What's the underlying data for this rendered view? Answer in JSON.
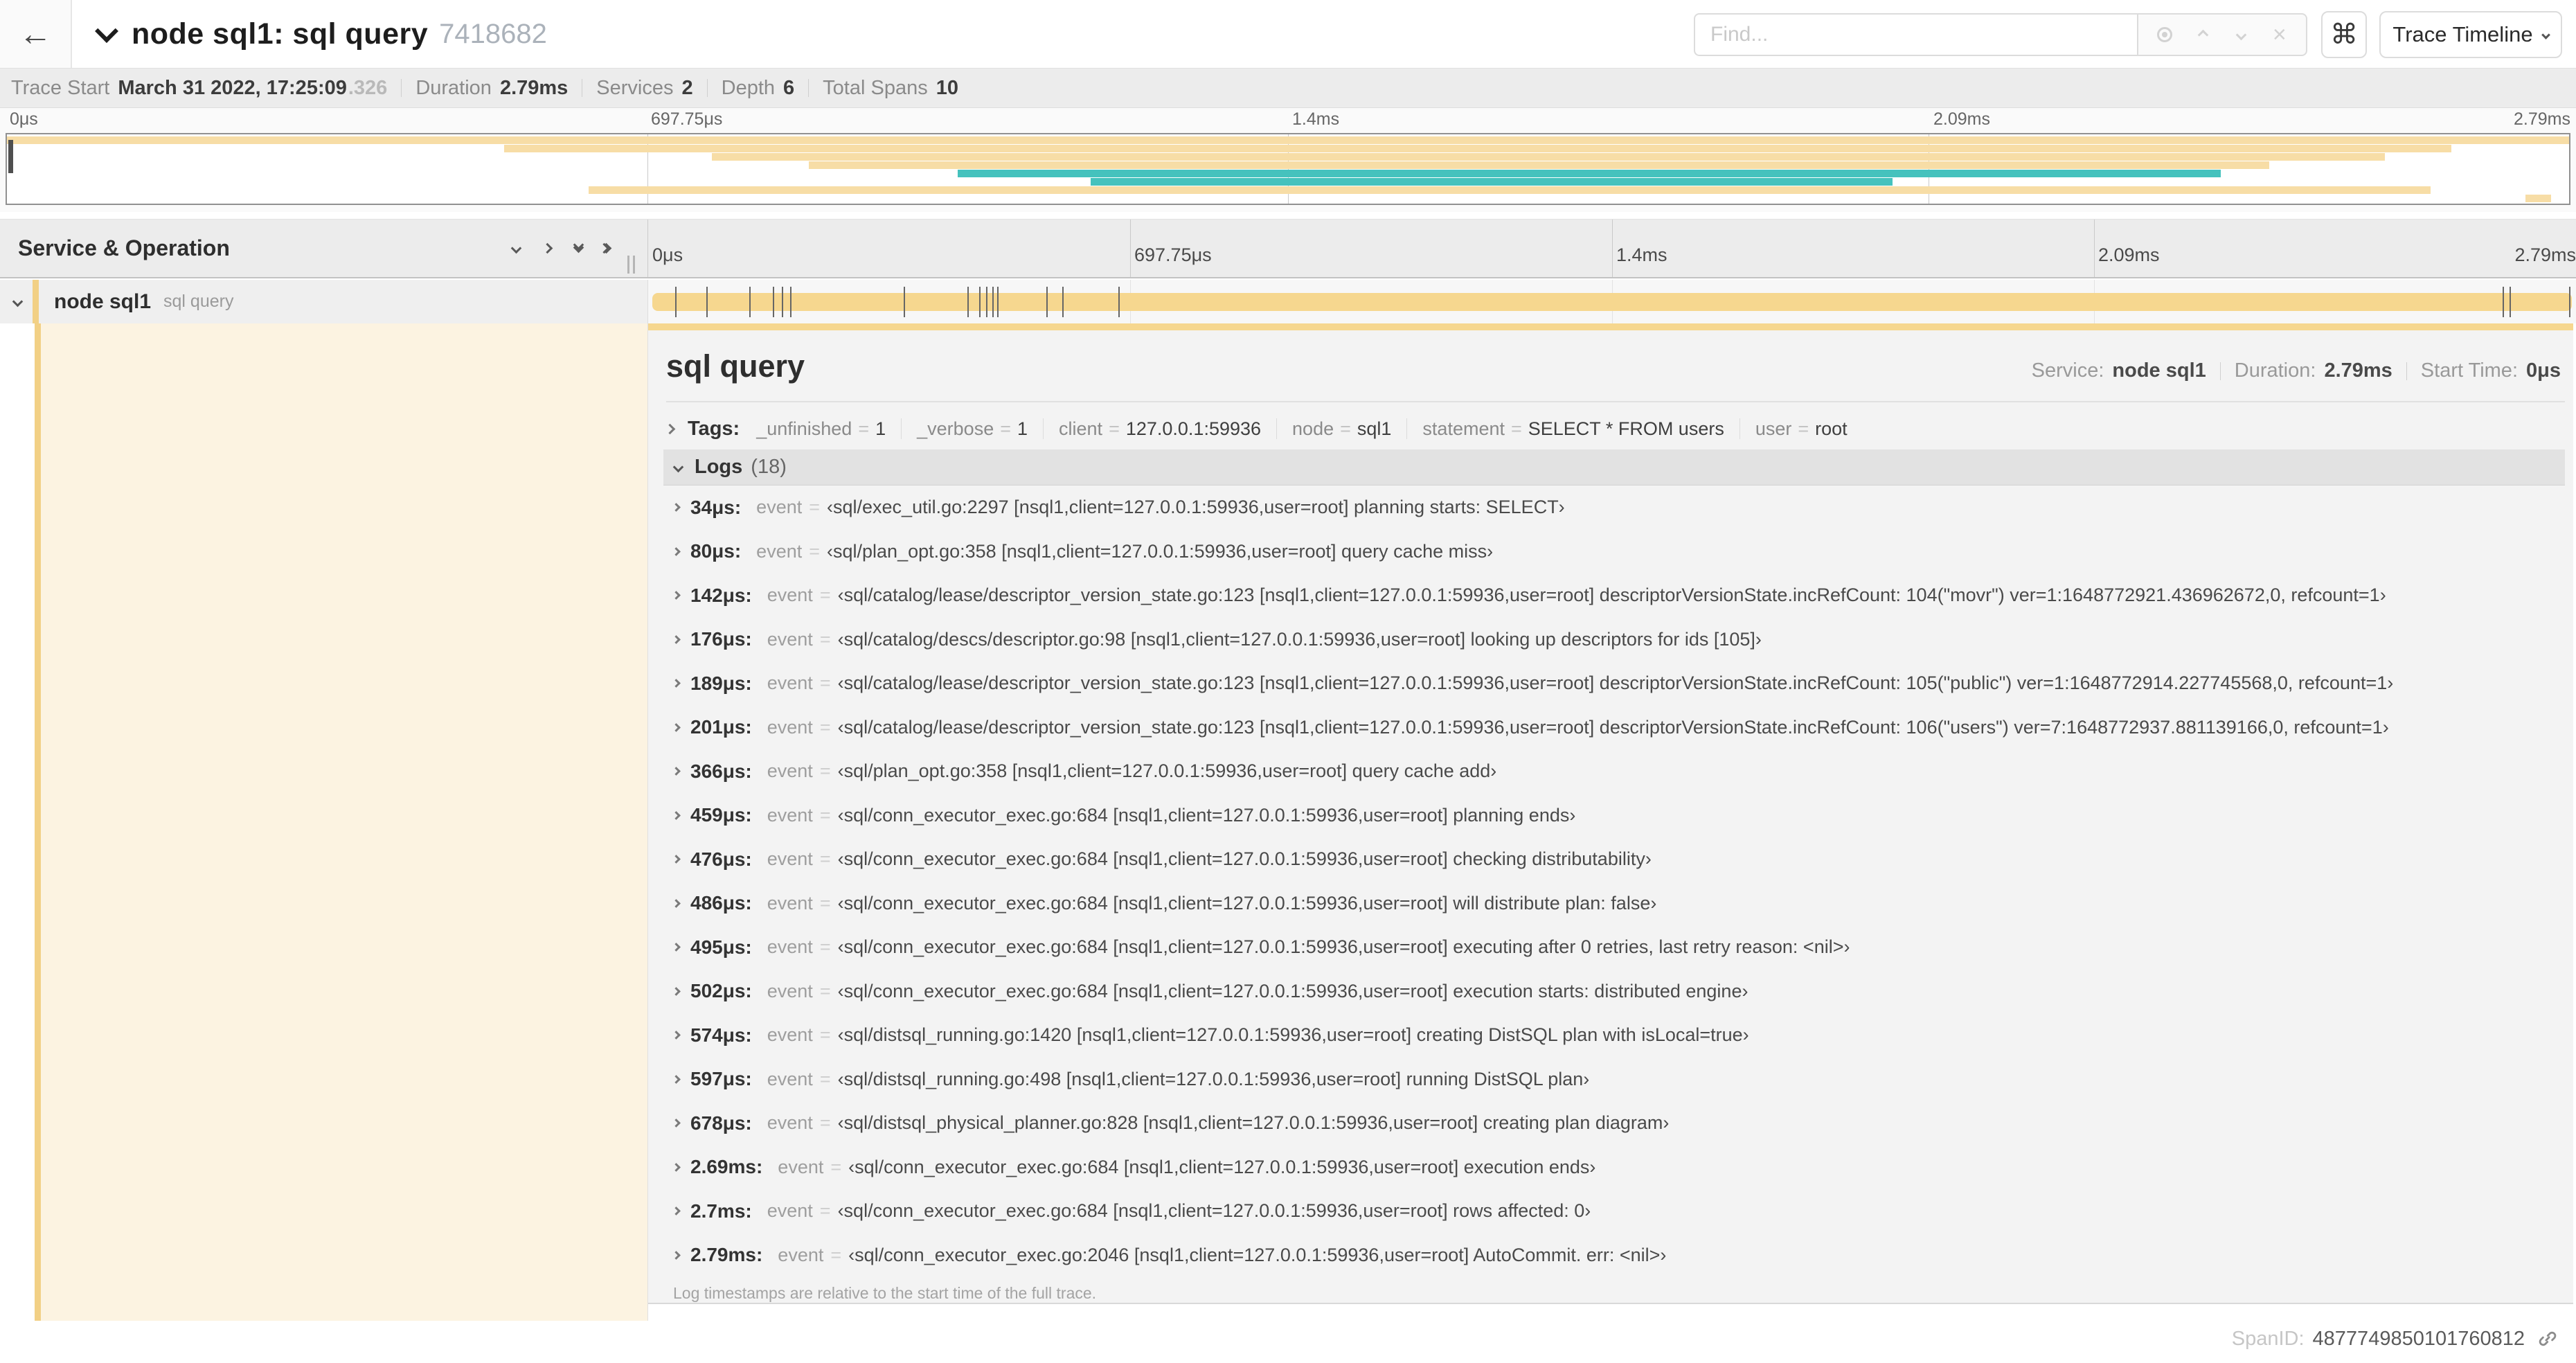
{
  "header": {
    "back_icon": "←",
    "title": "node sql1: sql query",
    "trace_id": "7418682",
    "find_placeholder": "Find...",
    "shortcut_icon": "⌘",
    "clear_icon": "×",
    "view_selector_label": "Trace Timeline"
  },
  "summary": {
    "items": [
      {
        "label": "Trace Start",
        "value": "March 31 2022, 17:25:09",
        "suffix": ".326"
      },
      {
        "label": "Duration",
        "value": "2.79ms"
      },
      {
        "label": "Services",
        "value": "2"
      },
      {
        "label": "Depth",
        "value": "6"
      },
      {
        "label": "Total Spans",
        "value": "10"
      }
    ]
  },
  "minimap": {
    "ticks": [
      "0μs",
      "697.75μs",
      "1.4ms",
      "2.09ms",
      "2.79ms"
    ],
    "spans": [
      {
        "start": 0,
        "end": 100,
        "color": "#f7dda6"
      },
      {
        "start": 19.4,
        "end": 95.4,
        "color": "#f7dda6"
      },
      {
        "start": 27.5,
        "end": 92.8,
        "color": "#f7dda6"
      },
      {
        "start": 31.3,
        "end": 88.3,
        "color": "#f7dda6"
      },
      {
        "start": 37.1,
        "end": 86.4,
        "color": "#45c2bd"
      },
      {
        "start": 42.3,
        "end": 73.6,
        "color": "#45c2bd"
      },
      {
        "start": 22.7,
        "end": 94.6,
        "color": "#f7dda6"
      },
      {
        "start": 98.3,
        "end": 99.3,
        "color": "#f7dda6"
      }
    ]
  },
  "timeline": {
    "left_header": "Service & Operation",
    "ticks": [
      "0μs",
      "697.75μs",
      "1.4ms",
      "2.09ms",
      "2.79ms"
    ],
    "total_us": 2790,
    "span": {
      "service": "node sql1",
      "operation": "sql query"
    }
  },
  "detail": {
    "title": "sql query",
    "meta": [
      {
        "label": "Service:",
        "value": "node sql1"
      },
      {
        "label": "Duration:",
        "value": "2.79ms"
      },
      {
        "label": "Start Time:",
        "value": "0μs"
      }
    ],
    "tags_label": "Tags:",
    "tags": [
      {
        "key": "_unfinished",
        "value": "1"
      },
      {
        "key": "_verbose",
        "value": "1"
      },
      {
        "key": "client",
        "value": "127.0.0.1:59936"
      },
      {
        "key": "node",
        "value": "sql1"
      },
      {
        "key": "statement",
        "value": "SELECT * FROM users"
      },
      {
        "key": "user",
        "value": "root"
      }
    ],
    "logs_label": "Logs",
    "logs_count_display": "(18)",
    "logs": [
      {
        "time": "34μs:",
        "t_us": 34,
        "key": "event",
        "value": "‹sql/exec_util.go:2297 [nsql1,client=127.0.0.1:59936,user=root] planning starts: SELECT›"
      },
      {
        "time": "80μs:",
        "t_us": 80,
        "key": "event",
        "value": "‹sql/plan_opt.go:358 [nsql1,client=127.0.0.1:59936,user=root] query cache miss›"
      },
      {
        "time": "142μs:",
        "t_us": 142,
        "key": "event",
        "value": "‹sql/catalog/lease/descriptor_version_state.go:123 [nsql1,client=127.0.0.1:59936,user=root] descriptorVersionState.incRefCount: 104(\"movr\") ver=1:1648772921.436962672,0, refcount=1›"
      },
      {
        "time": "176μs:",
        "t_us": 176,
        "key": "event",
        "value": "‹sql/catalog/descs/descriptor.go:98 [nsql1,client=127.0.0.1:59936,user=root] looking up descriptors for ids [105]›"
      },
      {
        "time": "189μs:",
        "t_us": 189,
        "key": "event",
        "value": "‹sql/catalog/lease/descriptor_version_state.go:123 [nsql1,client=127.0.0.1:59936,user=root] descriptorVersionState.incRefCount: 105(\"public\") ver=1:1648772914.227745568,0, refcount=1›"
      },
      {
        "time": "201μs:",
        "t_us": 201,
        "key": "event",
        "value": "‹sql/catalog/lease/descriptor_version_state.go:123 [nsql1,client=127.0.0.1:59936,user=root] descriptorVersionState.incRefCount: 106(\"users\") ver=7:1648772937.881139166,0, refcount=1›"
      },
      {
        "time": "366μs:",
        "t_us": 366,
        "key": "event",
        "value": "‹sql/plan_opt.go:358 [nsql1,client=127.0.0.1:59936,user=root] query cache add›"
      },
      {
        "time": "459μs:",
        "t_us": 459,
        "key": "event",
        "value": "‹sql/conn_executor_exec.go:684 [nsql1,client=127.0.0.1:59936,user=root] planning ends›"
      },
      {
        "time": "476μs:",
        "t_us": 476,
        "key": "event",
        "value": "‹sql/conn_executor_exec.go:684 [nsql1,client=127.0.0.1:59936,user=root] checking distributability›"
      },
      {
        "time": "486μs:",
        "t_us": 486,
        "key": "event",
        "value": "‹sql/conn_executor_exec.go:684 [nsql1,client=127.0.0.1:59936,user=root] will distribute plan: false›"
      },
      {
        "time": "495μs:",
        "t_us": 495,
        "key": "event",
        "value": "‹sql/conn_executor_exec.go:684 [nsql1,client=127.0.0.1:59936,user=root] executing after 0 retries, last retry reason: <nil>›"
      },
      {
        "time": "502μs:",
        "t_us": 502,
        "key": "event",
        "value": "‹sql/conn_executor_exec.go:684 [nsql1,client=127.0.0.1:59936,user=root] execution starts: distributed engine›"
      },
      {
        "time": "574μs:",
        "t_us": 574,
        "key": "event",
        "value": "‹sql/distsql_running.go:1420 [nsql1,client=127.0.0.1:59936,user=root] creating DistSQL plan with isLocal=true›"
      },
      {
        "time": "597μs:",
        "t_us": 597,
        "key": "event",
        "value": "‹sql/distsql_running.go:498 [nsql1,client=127.0.0.1:59936,user=root] running DistSQL plan›"
      },
      {
        "time": "678μs:",
        "t_us": 678,
        "key": "event",
        "value": "‹sql/distsql_physical_planner.go:828 [nsql1,client=127.0.0.1:59936,user=root] creating plan diagram›"
      },
      {
        "time": "2.69ms:",
        "t_us": 2690,
        "key": "event",
        "value": "‹sql/conn_executor_exec.go:684 [nsql1,client=127.0.0.1:59936,user=root] execution ends›"
      },
      {
        "time": "2.7ms:",
        "t_us": 2700,
        "key": "event",
        "value": "‹sql/conn_executor_exec.go:684 [nsql1,client=127.0.0.1:59936,user=root] rows affected: 0›"
      },
      {
        "time": "2.79ms:",
        "t_us": 2790,
        "key": "event",
        "value": "‹sql/conn_executor_exec.go:2046 [nsql1,client=127.0.0.1:59936,user=root] AutoCommit. err: <nil>›"
      }
    ],
    "footer_note": "Log timestamps are relative to the start time of the full trace.",
    "span_id_label": "SpanID:",
    "span_id": "4877749850101760812"
  },
  "colors": {
    "span_bar": "#f6d78f",
    "minimap_tan": "#f7dda6",
    "teal": "#45c2bd",
    "stripe": "#f2d085",
    "cream": "#fcf3e1"
  }
}
